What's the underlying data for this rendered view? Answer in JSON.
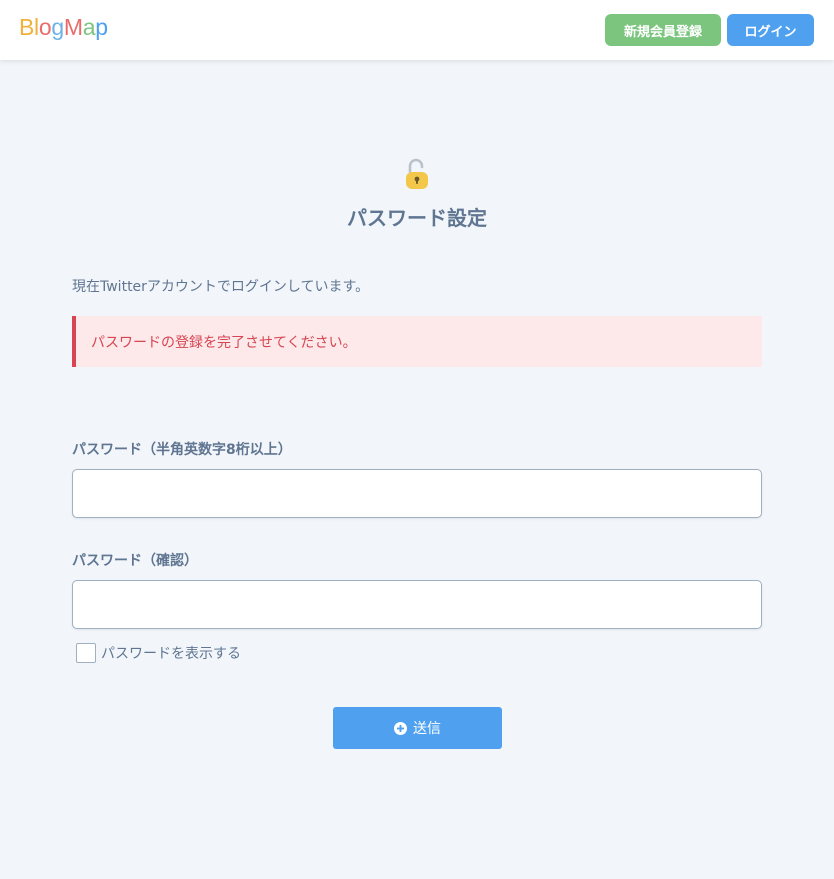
{
  "header": {
    "logo": {
      "letters": [
        "B",
        "l",
        "o",
        "g",
        "M",
        "a",
        "p"
      ],
      "letter_colors": [
        "#f0b23b",
        "#f0b23b",
        "#e86c6c",
        "#6bb3e6",
        "#e86c6c",
        "#7cc57e",
        "#4fa1f0"
      ]
    },
    "register_label": "新規会員登録",
    "login_label": "ログイン"
  },
  "main": {
    "icon": "unlocked-lock-icon",
    "title": "パスワード設定",
    "status_text": "現在Twitterアカウントでログインしています。",
    "alert_text": "パスワードの登録を完了させてください。",
    "password_label": "パスワード（半角英数字8桁以上）",
    "password_value": "",
    "confirm_label": "パスワード（確認）",
    "confirm_value": "",
    "show_password_label": "パスワードを表示する",
    "show_password_checked": false,
    "submit_label": "送信",
    "submit_icon": "plus-circle-icon"
  },
  "colors": {
    "background": "#f2f6fa",
    "register_button": "#7cc57e",
    "login_button": "#4fa1f0",
    "alert_bg": "#fde8ea",
    "alert_text": "#d64551",
    "text": "#5f7591"
  }
}
